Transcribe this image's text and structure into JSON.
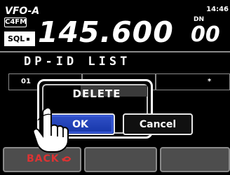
{
  "status": {
    "vfo_label": "VFO-A",
    "mode_badge": "C4FM",
    "sql_label": "SQL",
    "time": "14:46"
  },
  "frequency": {
    "main": "145.600",
    "minor": "00",
    "dn_tag": "DN"
  },
  "list": {
    "title": "DP-ID LIST",
    "first_row_label": "01",
    "right_row_label": "*"
  },
  "dialog": {
    "title": "DELETE",
    "ok_label": "OK",
    "cancel_label": "Cancel"
  },
  "softkeys": {
    "back_label": "BACK"
  },
  "colors": {
    "ok_button": "#1f3fb8",
    "back_text": "#dd3333"
  }
}
